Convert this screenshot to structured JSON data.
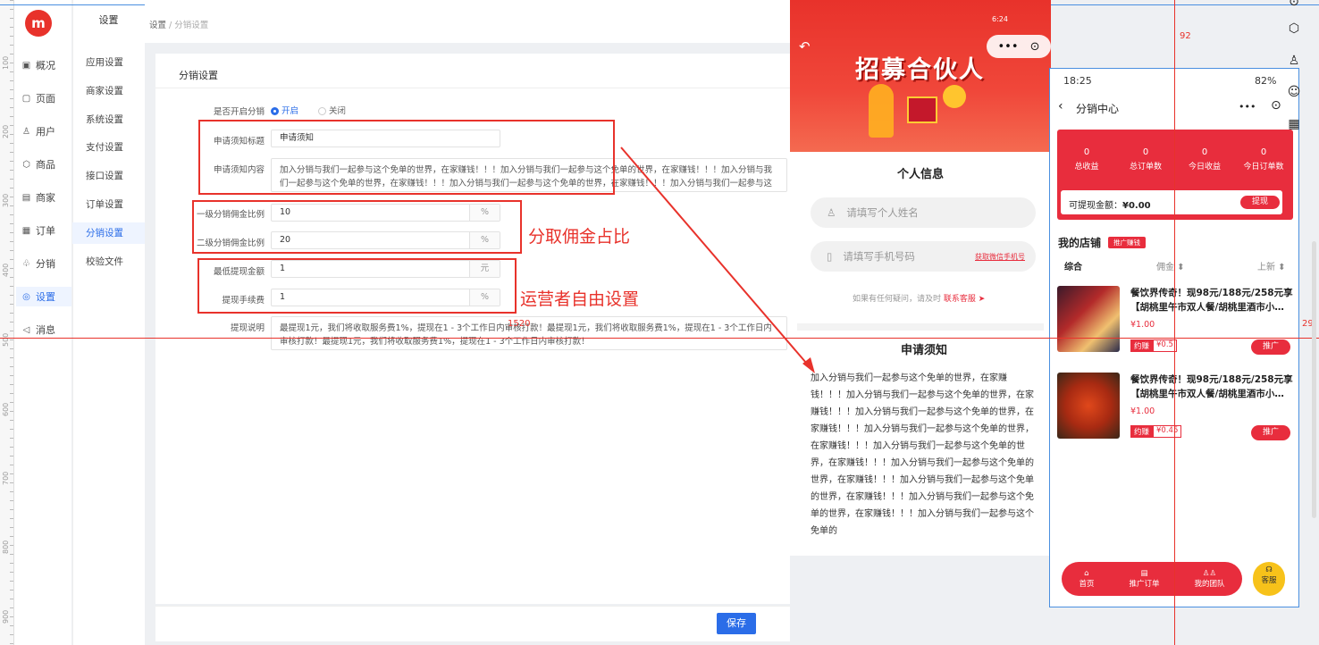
{
  "ruler": [
    "100",
    "200",
    "300",
    "400",
    "500",
    "600",
    "700",
    "800",
    "900"
  ],
  "guides": {
    "v_label": "92",
    "h_label": "1520",
    "r_label": "29"
  },
  "nav1": [
    {
      "icon": "▣",
      "label": "概况"
    },
    {
      "icon": "▢",
      "label": "页面"
    },
    {
      "icon": "♙",
      "label": "用户"
    },
    {
      "icon": "⬡",
      "label": "商品"
    },
    {
      "icon": "▤",
      "label": "商家"
    },
    {
      "icon": "▦",
      "label": "订单"
    },
    {
      "icon": "♧",
      "label": "分销"
    },
    {
      "icon": "◎",
      "label": "设置"
    },
    {
      "icon": "◁",
      "label": "消息"
    }
  ],
  "nav2_title": "设置",
  "nav2": [
    "应用设置",
    "商家设置",
    "系统设置",
    "支付设置",
    "接口设置",
    "订单设置",
    "分销设置",
    "校验文件"
  ],
  "breadcrumb": {
    "a": "设置",
    "sep": "/",
    "b": "分销设置"
  },
  "card_title": "分销设置",
  "form": {
    "enable_label": "是否开启分销",
    "enable_on": "开启",
    "enable_off": "关闭",
    "title_label": "申请须知标题",
    "title_value": "申请须知",
    "content_label": "申请须知内容",
    "content_value": "加入分销与我们一起参与这个免单的世界，在家赚钱！！！加入分销与我们一起参与这个免单的世界，在家赚钱！！！加入分销与我们一起参与这个免单的世界，在家赚钱！！！加入分销与我们一起参与这个免单的世界，在家赚钱！！！加入分销与我们一起参与这个免单的世界，在家赚钱！！！",
    "lv1_label": "一级分销佣金比例",
    "lv1_value": "10",
    "lv1_unit": "%",
    "lv2_label": "二级分销佣金比例",
    "lv2_value": "20",
    "lv2_unit": "%",
    "min_label": "最低提现金额",
    "min_value": "1",
    "min_unit": "元",
    "fee_label": "提现手续费",
    "fee_value": "1",
    "fee_unit": "%",
    "desc_label": "提现说明",
    "desc_value": "最提现1元，我们将收取服务费1%，提现在1 - 3个工作日内审核打款！最提现1元，我们将收取服务费1%，提现在1 - 3个工作日内审核打款！最提现1元，我们将收取服务费1%，提现在1 - 3个工作日内审核打款！"
  },
  "annotations": {
    "a1": "分取佣金占比",
    "a2": "运营者自由设置"
  },
  "save": "保存",
  "phone1": {
    "status": "6:24",
    "title": "招募合伙人",
    "capsule_dots": "•••",
    "capsule_circle": "⊙",
    "info_title": "个人信息",
    "name_ph": "请填写个人姓名",
    "phone_ph": "请填写手机号码",
    "wx_btn": "获取微信手机号",
    "help": "如果有任何疑问，请及时",
    "help_link": "联系客服",
    "notice_title": "申请须知",
    "notice_text": "加入分销与我们一起参与这个免单的世界，在家赚钱！！！加入分销与我们一起参与这个免单的世界，在家赚钱！！！加入分销与我们一起参与这个免单的世界，在家赚钱！！！加入分销与我们一起参与这个免单的世界，在家赚钱！！！加入分销与我们一起参与这个免单的世界，在家赚钱！！！加入分销与我们一起参与这个免单的世界，在家赚钱！！！加入分销与我们一起参与这个免单的世界，在家赚钱！！！加入分销与我们一起参与这个免单的世界，在家赚钱！！！加入分销与我们一起参与这个免单的"
  },
  "phone2": {
    "time": "18:25",
    "battery": "82%",
    "title": "分销中心",
    "stats": [
      {
        "n": "0",
        "l": "总收益"
      },
      {
        "n": "0",
        "l": "总订单数"
      },
      {
        "n": "0",
        "l": "今日收益"
      },
      {
        "n": "0",
        "l": "今日订单数"
      }
    ],
    "withdraw_label": "可提现金额：",
    "withdraw_value": "¥0.00",
    "withdraw_btn": "提现",
    "shop": "我的店铺",
    "shop_badge": "推广赚钱",
    "sort": [
      "综合",
      "佣金 ⬍",
      "上新 ⬍"
    ],
    "products": [
      {
        "title1": "餐饮界传奇！现98元/188元/258元享",
        "title2": "【胡桃里午市双人餐/胡桃里酒市小…",
        "price": "¥1.00",
        "earn": "约赚",
        "earn_val": "¥0.5",
        "btn": "推广"
      },
      {
        "title1": "餐饮界传奇！现98元/188元/258元享",
        "title2": "【胡桃里午市双人餐/胡桃里酒市小…",
        "price": "¥1.00",
        "earn": "约赚",
        "earn_val": "¥0.45",
        "btn": "推广"
      }
    ],
    "tabs": [
      "首页",
      "推广订单",
      "我的团队"
    ],
    "kefu": "客服"
  },
  "right_icons": [
    "⊙",
    "⬡",
    "♙",
    "☺",
    "▦"
  ]
}
